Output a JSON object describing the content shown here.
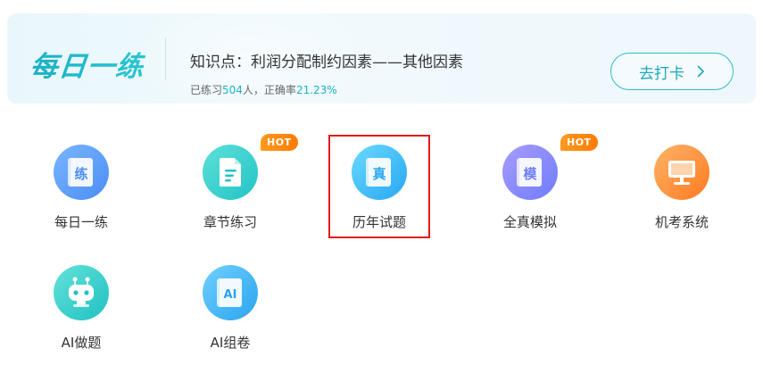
{
  "banner": {
    "brand": "每日一练",
    "knowledge_point": "知识点：利润分配制约因素——其他因素",
    "stats_prefix": "已练习",
    "practiced_count": "504",
    "stats_middle": "人，正确率",
    "accuracy": "21.23%",
    "button_label": "去打卡"
  },
  "tiles": [
    {
      "label": "每日一练",
      "glyph": "练",
      "hot": "",
      "icon": "daily-practice-icon"
    },
    {
      "label": "章节练习",
      "glyph": "",
      "hot": "HOT",
      "icon": "document-icon"
    },
    {
      "label": "历年试题",
      "glyph": "真",
      "hot": "",
      "icon": "past-exams-icon"
    },
    {
      "label": "全真模拟",
      "glyph": "模",
      "hot": "HOT",
      "icon": "mock-exam-icon"
    },
    {
      "label": "机考系统",
      "glyph": "",
      "hot": "",
      "icon": "computer-icon"
    },
    {
      "label": "AI做题",
      "glyph": "",
      "hot": "",
      "icon": "robot-icon"
    },
    {
      "label": "AI组卷",
      "glyph": "AI",
      "hot": "",
      "icon": "ai-paper-icon"
    }
  ],
  "colors": {
    "accent": "#19b3c4",
    "hot": "#ff8a00",
    "selection": "#e21b1b"
  }
}
